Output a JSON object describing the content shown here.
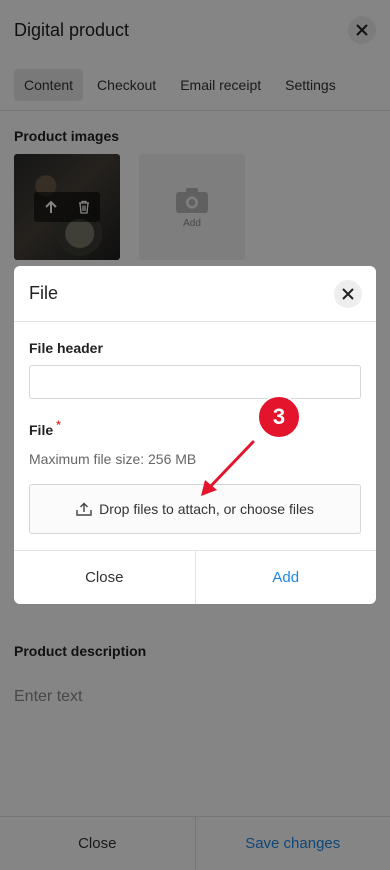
{
  "header": {
    "title": "Digital product"
  },
  "tabs": [
    {
      "label": "Content",
      "active": true
    },
    {
      "label": "Checkout",
      "active": false
    },
    {
      "label": "Email receipt",
      "active": false
    },
    {
      "label": "Settings",
      "active": false
    }
  ],
  "product_images": {
    "label": "Product images",
    "add_label": "Add"
  },
  "description": {
    "label": "Product description",
    "placeholder": "Enter text"
  },
  "footer": {
    "close_label": "Close",
    "save_label": "Save changes"
  },
  "modal": {
    "title": "File",
    "file_header_label": "File header",
    "file_header_value": "",
    "file_label": "File",
    "required_mark": "*",
    "hint": "Maximum file size: 256 MB",
    "dropzone_text": "Drop files to attach, or choose files",
    "close_label": "Close",
    "add_label": "Add"
  },
  "annotation": {
    "step": "3"
  },
  "colors": {
    "accent": "#1e88e5",
    "badge": "#e3142b",
    "required": "#e53935"
  }
}
